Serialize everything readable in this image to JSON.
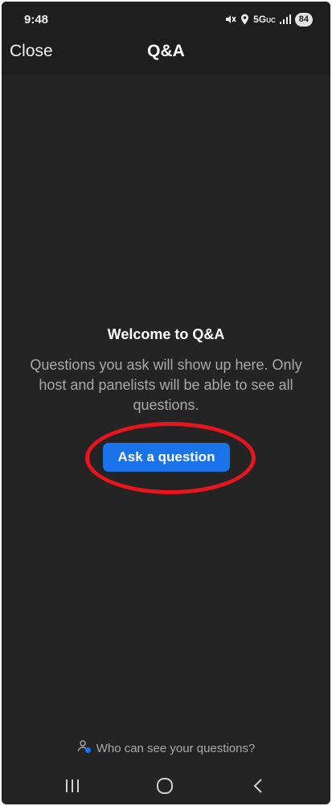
{
  "status_bar": {
    "time": "9:48",
    "network": "5G",
    "network_suffix": "UC",
    "battery": "84",
    "icons": [
      "mute-icon",
      "location-icon",
      "signal-icon"
    ]
  },
  "header": {
    "close_label": "Close",
    "title": "Q&A"
  },
  "empty_state": {
    "title": "Welcome to Q&A",
    "description": "Questions you ask will show up here. Only host and panelists will be able to see all questions.",
    "ask_button_label": "Ask a question",
    "highlight_color": "#e8141e",
    "button_color": "#1a73e8"
  },
  "footer": {
    "visibility_link": "Who can see your questions?",
    "icon": "person-visibility-icon"
  },
  "nav_bar": {
    "buttons": [
      "recents-icon",
      "home-icon",
      "back-icon"
    ]
  }
}
